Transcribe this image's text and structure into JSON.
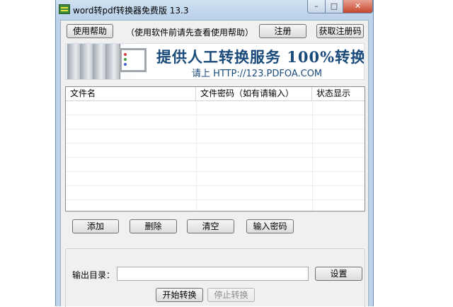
{
  "window": {
    "title": "word转pdf转换器免费版 13.3",
    "minimize_glyph": "–",
    "maximize_glyph": "□",
    "close_glyph": "✕"
  },
  "toolbar": {
    "help_button": "使用帮助",
    "help_hint": "（使用软件前请先查看使用帮助）",
    "register_button": "注册",
    "get_code_button": "获取注册码"
  },
  "banner": {
    "headline": "提供人工转换服务 100%转换",
    "subline": "请上  HTTP://123.PDFOA.COM"
  },
  "file_table": {
    "columns": [
      "文件名",
      "文件密码（如有请输入）",
      "状态显示"
    ],
    "rows": []
  },
  "actions": {
    "add": "添加",
    "delete": "删除",
    "clear": "清空",
    "enter_password": "输入密码"
  },
  "output": {
    "dir_label": "输出目录：",
    "dir_value": "",
    "settings_button": "设置",
    "start_button": "开始转换",
    "stop_button": "停止转换"
  },
  "colors": {
    "window_frame": "#bcd3ea",
    "client_bg": "#f0f0f0",
    "banner_text": "#1a4a7a",
    "close_button": "#c5462e"
  }
}
